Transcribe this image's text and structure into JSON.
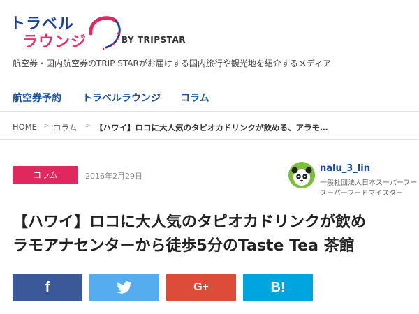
{
  "header": {
    "logo_line1": "トラベル",
    "logo_line2": "ラウンジ",
    "logo_suffix": "BY TRIPSTAR",
    "tagline": "航空券・国内航空券のTRIP STARがお届けする国内旅行や観光地を紹介するメディア"
  },
  "nav": {
    "items": [
      {
        "label": "航空券予約"
      },
      {
        "label": "トラベルラウンジ"
      },
      {
        "label": "コラム"
      }
    ]
  },
  "breadcrumb": {
    "items": [
      {
        "label": "HOME"
      },
      {
        "label": "コラム"
      },
      {
        "label": "【ハワイ】ロコに大人気のタピオカドリンクが飲める、アラモ…"
      }
    ]
  },
  "article": {
    "category": "コラム",
    "date": "2016年2月29日",
    "title_line1": "【ハワイ】ロコに大人気のタピオカドリンクが飲め",
    "title_line2": "ラモアナセンターから徒歩5分のTaste Tea 茶館"
  },
  "author": {
    "name": "nalu_3_lin",
    "desc_line1": "一般社団法人日本スーパーフー",
    "desc_line2": "スーパーフードマイスター",
    "avatar_icon": "panda-icon"
  },
  "share": {
    "facebook": {
      "glyph": "f",
      "icon": "facebook-icon",
      "color": "#3b5998"
    },
    "twitter": {
      "glyph": "🐦",
      "icon": "twitter-icon",
      "color": "#55acee"
    },
    "googleplus": {
      "glyph": "G+",
      "icon": "google-plus-icon",
      "color": "#dd4b39"
    },
    "hatena": {
      "glyph": "B!",
      "icon": "hatena-bookmark-icon",
      "color": "#00a4de"
    }
  },
  "colors": {
    "brand_blue": "#1a4e9c",
    "brand_pink": "#e0285e"
  }
}
